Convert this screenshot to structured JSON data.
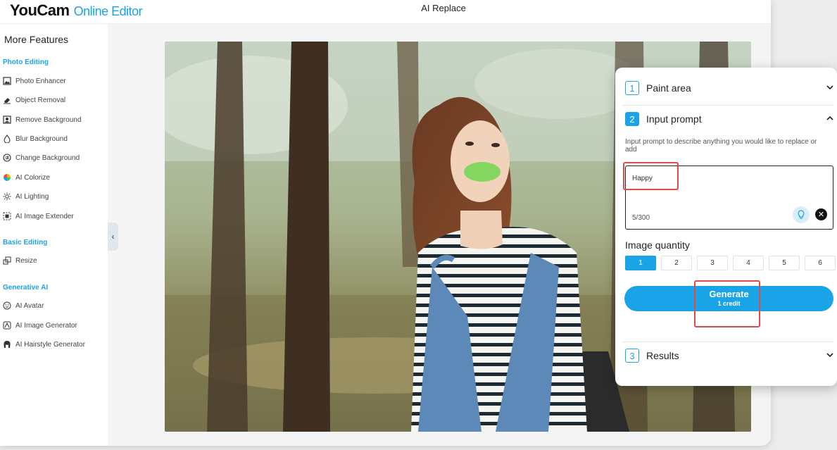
{
  "header": {
    "brand": "YouCam",
    "brand_sub": "Online Editor",
    "page_title": "AI Replace"
  },
  "sidebar": {
    "title": "More Features",
    "sections": [
      {
        "label": "Photo Editing",
        "items": [
          {
            "label": "Photo Enhancer",
            "icon": "image-icon"
          },
          {
            "label": "Object Removal",
            "icon": "eraser-icon"
          },
          {
            "label": "Remove Background",
            "icon": "portrait-icon"
          },
          {
            "label": "Blur Background",
            "icon": "drop-icon"
          },
          {
            "label": "Change Background",
            "icon": "swap-icon"
          },
          {
            "label": "AI Colorize",
            "icon": "color-wheel-icon"
          },
          {
            "label": "AI Lighting",
            "icon": "light-icon"
          },
          {
            "label": "AI Image Extender",
            "icon": "expand-icon"
          }
        ]
      },
      {
        "label": "Basic Editing",
        "items": [
          {
            "label": "Resize",
            "icon": "resize-icon"
          }
        ]
      },
      {
        "label": "Generative AI",
        "items": [
          {
            "label": "AI Avatar",
            "icon": "avatar-icon"
          },
          {
            "label": "AI Image Generator",
            "icon": "image-generator-icon"
          },
          {
            "label": "AI Hairstyle Generator",
            "icon": "hairstyle-icon"
          }
        ]
      }
    ]
  },
  "panel": {
    "steps": [
      {
        "num": "1",
        "label": "Paint area"
      },
      {
        "num": "2",
        "label": "Input prompt"
      },
      {
        "num": "3",
        "label": "Results"
      }
    ],
    "prompt_description": "Input prompt to describe anything you would like to replace or add",
    "prompt_value": "Happy",
    "prompt_counter": "5/300",
    "quantity_label": "Image quantity",
    "quantity_options": [
      "1",
      "2",
      "3",
      "4",
      "5",
      "6"
    ],
    "quantity_selected": "1",
    "generate_label": "Generate",
    "generate_credit": "1 credit"
  },
  "colors": {
    "accent": "#1aa3e6",
    "highlight": "#e04a4a",
    "paint_mask": "#7cd65a"
  }
}
